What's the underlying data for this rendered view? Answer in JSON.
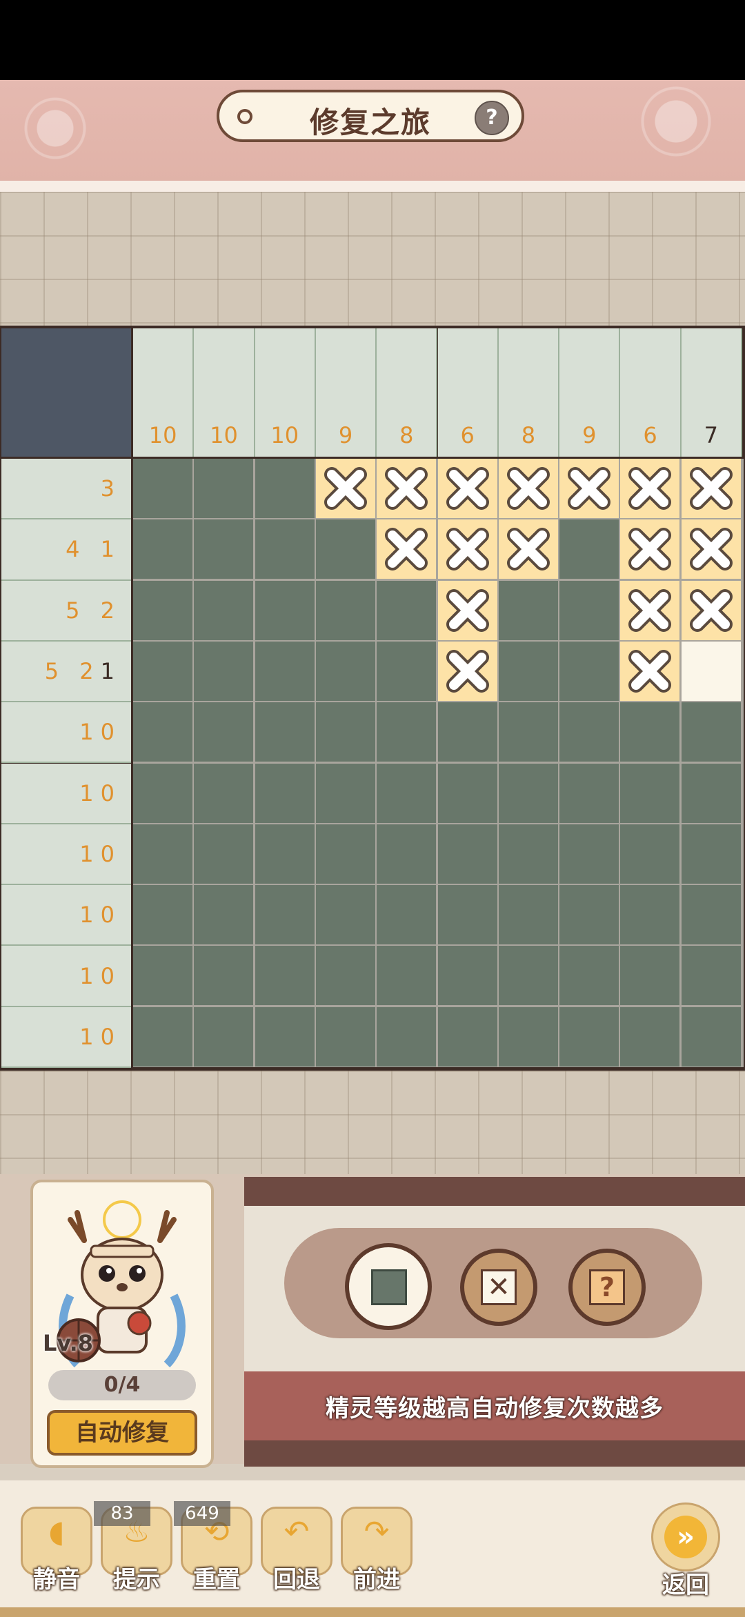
{
  "header": {
    "title": "修复之旅",
    "help_glyph": "?"
  },
  "puzzle": {
    "column_clues": [
      {
        "text": "10",
        "done": false
      },
      {
        "text": "10",
        "done": false
      },
      {
        "text": "10",
        "done": false
      },
      {
        "text": "9",
        "done": false
      },
      {
        "text": "8",
        "done": false
      },
      {
        "text": "6",
        "done": false
      },
      {
        "text": "8",
        "done": false
      },
      {
        "text": "9",
        "done": false
      },
      {
        "text": "6",
        "done": false
      },
      {
        "text": "7",
        "done": true
      }
    ],
    "row_clues": [
      {
        "orange": "3",
        "dark": ""
      },
      {
        "orange": "4 1",
        "dark": ""
      },
      {
        "orange": "5 2",
        "dark": ""
      },
      {
        "orange": "5 2",
        "dark": "1"
      },
      {
        "orange": "10",
        "dark": ""
      },
      {
        "orange": "10",
        "dark": ""
      },
      {
        "orange": "10",
        "dark": ""
      },
      {
        "orange": "10",
        "dark": ""
      },
      {
        "orange": "10",
        "dark": ""
      },
      {
        "orange": "10",
        "dark": ""
      }
    ],
    "cells": [
      "FFFXXXXXXX",
      "FFFFXXXFXX",
      "FFFFFXFFXX",
      "FFFFFXFFXE",
      "FFFFFFFFFF",
      "FFFFFFFFFF",
      "FFFFFFFFFF",
      "FFFFFFFFFF",
      "FFFFFFFFFF",
      "FFFFFFFFFF"
    ],
    "colors": {
      "filled": "#68776a",
      "crossed": "#fde2a7",
      "empty": "#fbf6e9",
      "clue_orange": "#e0912e"
    }
  },
  "spirit": {
    "level": "Lv.8",
    "progress": "0/4",
    "auto_repair_label": "自动修复"
  },
  "tools": {
    "fill_icon": "filled-square-icon",
    "cross_glyph": "✕",
    "mark_glyph": "?"
  },
  "hint_text": "精灵等级越高自动修复次数越多",
  "toolbar": {
    "mute_label": "静音",
    "hint_label": "提示",
    "hint_count": "83",
    "reset_label": "重置",
    "reset_count": "649",
    "undo_label": "回退",
    "redo_label": "前进",
    "back_label": "返回"
  }
}
